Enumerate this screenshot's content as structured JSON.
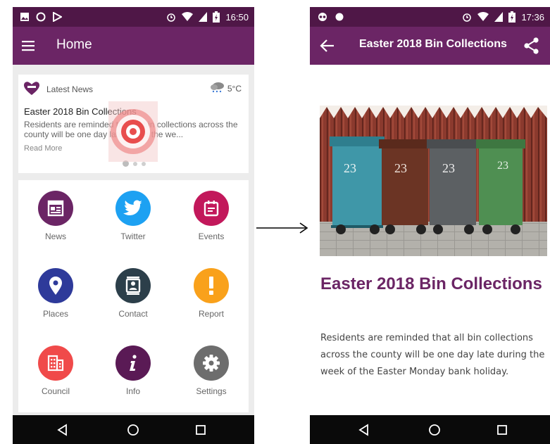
{
  "left_screen": {
    "status_bar": {
      "time": "16:50"
    },
    "app_bar": {
      "title": "Home",
      "menu_icon": "hamburger-menu-icon"
    },
    "news_card": {
      "header": "Latest News",
      "weather": "5°C",
      "title": "Easter 2018 Bin Collections",
      "summary": "Residents are reminded that all bin collections across the county will be one day late during the we...",
      "read_more": "Read More",
      "pager": {
        "count": 3,
        "active": 0
      }
    },
    "grid": [
      {
        "label": "News",
        "icon": "newspaper-icon",
        "color": "#6b2565"
      },
      {
        "label": "Twitter",
        "icon": "twitter-icon",
        "color": "#1da1f2"
      },
      {
        "label": "Events",
        "icon": "calendar-icon",
        "color": "#c2185b"
      },
      {
        "label": "Places",
        "icon": "location-pin-icon",
        "color": "#2e3a9a"
      },
      {
        "label": "Contact",
        "icon": "contact-card-icon",
        "color": "#2c3f4a"
      },
      {
        "label": "Report",
        "icon": "exclamation-icon",
        "color": "#f9a11b"
      },
      {
        "label": "Council",
        "icon": "building-icon",
        "color": "#f04a4a"
      },
      {
        "label": "Info",
        "icon": "info-icon",
        "color": "#5a1a55"
      },
      {
        "label": "Settings",
        "icon": "gear-icon",
        "color": "#6d6d6d"
      }
    ]
  },
  "right_screen": {
    "status_bar": {
      "time": "17:36"
    },
    "app_bar": {
      "title": "Easter 2018 Bin Collections",
      "back_icon": "back-arrow-icon",
      "share_icon": "share-icon"
    },
    "article": {
      "title": "Easter 2018 Bin Collections",
      "body": "Residents are reminded that all bin collections across the county will be one day late during the week of the Easter Monday bank holiday.",
      "bin_number": "23"
    }
  },
  "colors": {
    "primary": "#6b2565",
    "status_bar": "#4f1747",
    "nav_bar": "#0a0a0a",
    "title": "#6b2565"
  }
}
